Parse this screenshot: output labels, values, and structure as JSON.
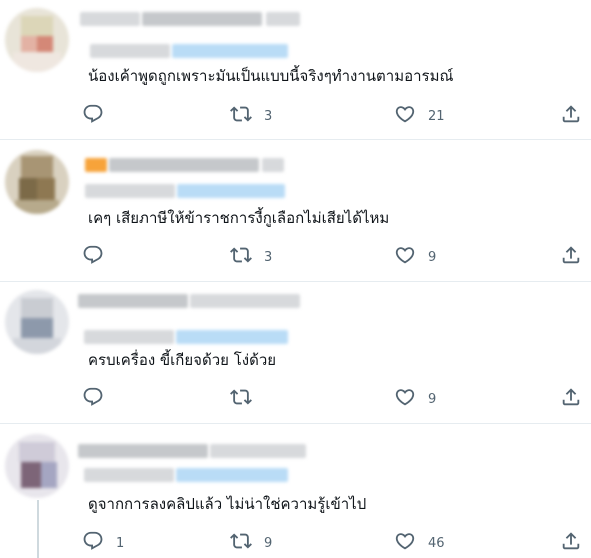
{
  "replies": [
    {
      "text": "น้องเค้าพูดถูกเพราะมันเป็นแบบนี้จริงๆทำงานตามอารมณ์",
      "reply_count": "",
      "retweet_count": "3",
      "like_count": "21"
    },
    {
      "text": "เคๆ เสียภาษีให้ข้าราชการงี้กูเลือกไม่เสียได้ไหม",
      "reply_count": "",
      "retweet_count": "3",
      "like_count": "9"
    },
    {
      "text": "ครบเครื่อง ขี้เกียจด้วย โง่ด้วย",
      "reply_count": "",
      "retweet_count": "",
      "like_count": "9"
    },
    {
      "text": "ดูจากการลงคลิปแล้ว ไม่น่าใช่ความรู้เข้าไป",
      "reply_count": "1",
      "retweet_count": "9",
      "like_count": "46"
    }
  ],
  "icons": {
    "reply": "reply-icon",
    "retweet": "retweet-icon",
    "like": "heart-icon",
    "share": "share-icon"
  },
  "colors": {
    "icon": "#536471",
    "divider": "#e6ecf0",
    "text": "#0f1419"
  }
}
